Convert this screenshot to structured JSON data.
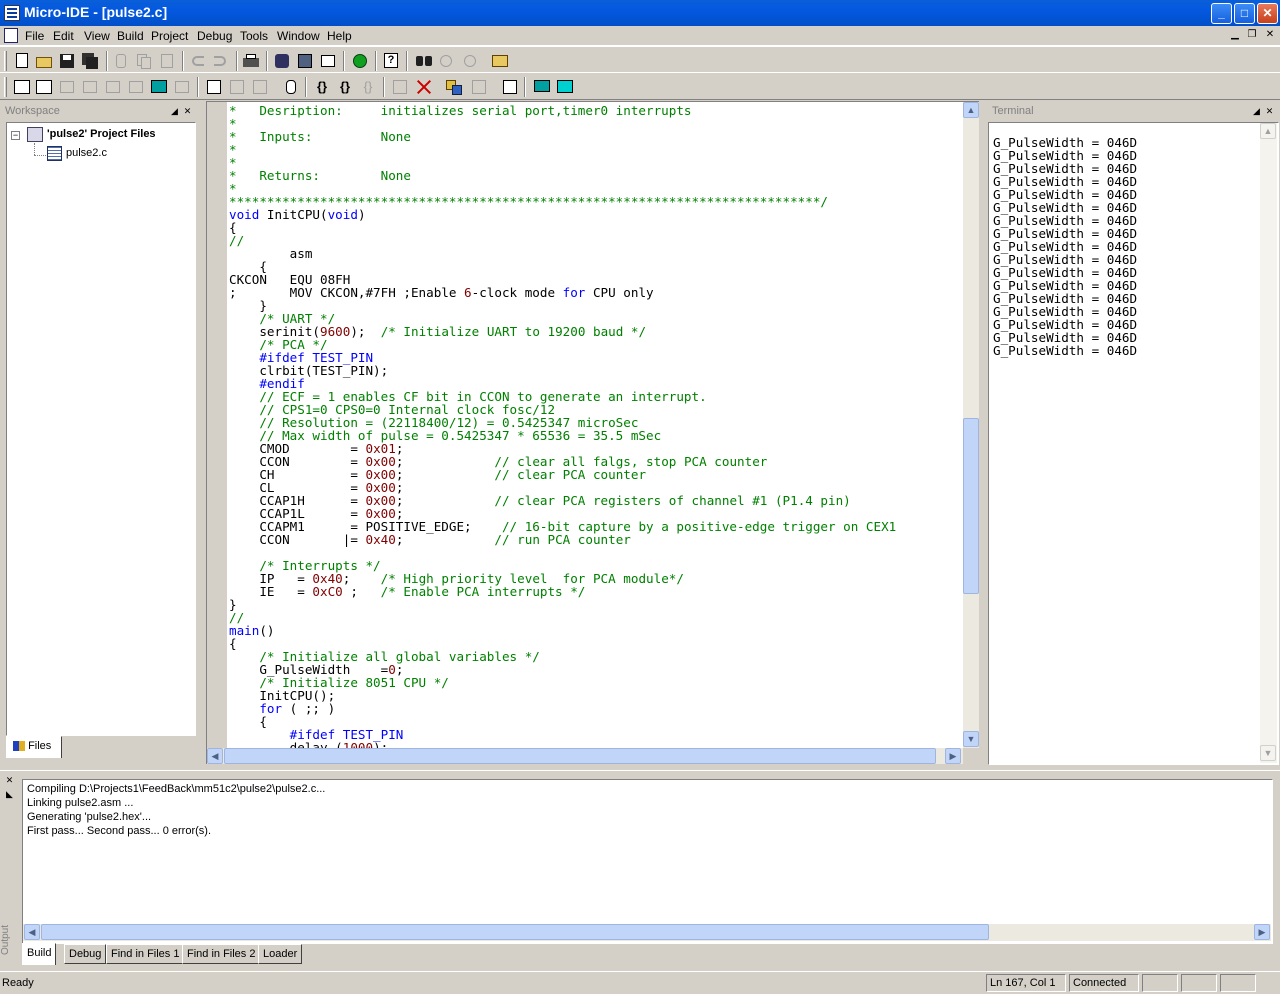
{
  "window": {
    "title": "Micro-IDE - [pulse2.c]",
    "controls": {
      "minimize": "_",
      "maximize": "□",
      "close": "✕"
    }
  },
  "menu": [
    "File",
    "Edit",
    "View",
    "Build",
    "Project",
    "Debug",
    "Tools",
    "Window",
    "Help"
  ],
  "workspace": {
    "title": "Workspace",
    "project_label": "'pulse2' Project Files",
    "file": "pulse2.c",
    "tab": "Files"
  },
  "editor": {
    "lines": [
      [
        [
          "c-cm",
          "*   Desription:     initializes serial port,timer0 interrupts"
        ]
      ],
      [
        [
          "c-cm",
          "*"
        ]
      ],
      [
        [
          "c-cm",
          "*   Inputs:         None"
        ]
      ],
      [
        [
          "c-cm",
          "*"
        ]
      ],
      [
        [
          "c-cm",
          "*"
        ]
      ],
      [
        [
          "c-cm",
          "*   Returns:        None"
        ]
      ],
      [
        [
          "c-cm",
          "*"
        ]
      ],
      [
        [
          "c-cm",
          "******************************************************************************/"
        ]
      ],
      [
        [
          "c-kw",
          "void"
        ],
        [
          "c-tx",
          " InitCPU("
        ],
        [
          "c-kw",
          "void"
        ],
        [
          "c-tx",
          ")"
        ]
      ],
      [
        [
          "c-tx",
          "{"
        ]
      ],
      [
        [
          "c-cm",
          "//"
        ]
      ],
      [
        [
          "c-tx",
          "        asm"
        ]
      ],
      [
        [
          "c-tx",
          "    {"
        ]
      ],
      [
        [
          "c-tx",
          "CKCON   EQU 08FH"
        ]
      ],
      [
        [
          "c-tx",
          ";       MOV CKCON,#7FH ;Enable "
        ],
        [
          "c-num",
          "6"
        ],
        [
          "c-tx",
          "-clock mode "
        ],
        [
          "c-kw",
          "for"
        ],
        [
          "c-tx",
          " CPU only"
        ]
      ],
      [
        [
          "c-tx",
          "    }"
        ]
      ],
      [
        [
          "c-cm",
          "    /* UART */"
        ]
      ],
      [
        [
          "c-tx",
          "    serinit("
        ],
        [
          "c-num",
          "9600"
        ],
        [
          "c-tx",
          ");  "
        ],
        [
          "c-cm",
          "/* Initialize UART to 19200 baud */"
        ]
      ],
      [
        [
          "c-cm",
          "    /* PCA */"
        ]
      ],
      [
        [
          "c-kw",
          "    #ifdef TEST_PIN"
        ]
      ],
      [
        [
          "c-tx",
          "    clrbit(TEST_PIN);"
        ]
      ],
      [
        [
          "c-kw",
          "    #endif"
        ]
      ],
      [
        [
          "c-cm",
          "    // ECF = 1 enables CF bit in CCON to generate an interrupt."
        ]
      ],
      [
        [
          "c-cm",
          "    // CPS1=0 CPS0=0 Internal clock fosc/12"
        ]
      ],
      [
        [
          "c-cm",
          "    // Resolution = (22118400/12) = 0.5425347 microSec"
        ]
      ],
      [
        [
          "c-cm",
          "    // Max width of pulse = 0.5425347 * 65536 = 35.5 mSec"
        ]
      ],
      [
        [
          "c-tx",
          "    CMOD        = "
        ],
        [
          "c-num",
          "0x01"
        ],
        [
          "c-tx",
          ";"
        ]
      ],
      [
        [
          "c-tx",
          "    CCON        = "
        ],
        [
          "c-num",
          "0x00"
        ],
        [
          "c-tx",
          ";            "
        ],
        [
          "c-cm",
          "// clear all falgs, stop PCA counter"
        ]
      ],
      [
        [
          "c-tx",
          "    CH          = "
        ],
        [
          "c-num",
          "0x00"
        ],
        [
          "c-tx",
          ";            "
        ],
        [
          "c-cm",
          "// clear PCA counter"
        ]
      ],
      [
        [
          "c-tx",
          "    CL          = "
        ],
        [
          "c-num",
          "0x00"
        ],
        [
          "c-tx",
          ";"
        ]
      ],
      [
        [
          "c-tx",
          "    CCAP1H      = "
        ],
        [
          "c-num",
          "0x00"
        ],
        [
          "c-tx",
          ";            "
        ],
        [
          "c-cm",
          "// clear PCA registers of channel #1 (P1.4 pin)"
        ]
      ],
      [
        [
          "c-tx",
          "    CCAP1L      = "
        ],
        [
          "c-num",
          "0x00"
        ],
        [
          "c-tx",
          ";"
        ]
      ],
      [
        [
          "c-tx",
          "    CCAPM1      = POSITIVE_EDGE;    "
        ],
        [
          "c-cm",
          "// 16-bit capture by a positive-edge trigger on CEX1"
        ]
      ],
      [
        [
          "c-tx",
          "    CCON       |= "
        ],
        [
          "c-num",
          "0x40"
        ],
        [
          "c-tx",
          ";            "
        ],
        [
          "c-cm",
          "// run PCA counter"
        ]
      ],
      [
        [
          "c-tx",
          ""
        ]
      ],
      [
        [
          "c-cm",
          "    /* Interrupts */"
        ]
      ],
      [
        [
          "c-tx",
          "    IP   = "
        ],
        [
          "c-num",
          "0x40"
        ],
        [
          "c-tx",
          ";    "
        ],
        [
          "c-cm",
          "/* High priority level  for PCA module*/"
        ]
      ],
      [
        [
          "c-tx",
          "    IE   = "
        ],
        [
          "c-num",
          "0xC0"
        ],
        [
          "c-tx",
          " ;   "
        ],
        [
          "c-cm",
          "/* Enable PCA interrupts */"
        ]
      ],
      [
        [
          "c-tx",
          "}"
        ]
      ],
      [
        [
          "c-cm",
          "//"
        ]
      ],
      [
        [
          "c-kw",
          "main"
        ],
        [
          "c-tx",
          "()"
        ]
      ],
      [
        [
          "c-tx",
          "{"
        ]
      ],
      [
        [
          "c-cm",
          "    /* Initialize all global variables */"
        ]
      ],
      [
        [
          "c-tx",
          "    G_PulseWidth    ="
        ],
        [
          "c-num",
          "0"
        ],
        [
          "c-tx",
          ";"
        ]
      ],
      [
        [
          "c-cm",
          "    /* Initialize 8051 CPU */"
        ]
      ],
      [
        [
          "c-tx",
          "    InitCPU();"
        ]
      ],
      [
        [
          "c-kw",
          "    for"
        ],
        [
          "c-tx",
          " ( ;; )"
        ]
      ],
      [
        [
          "c-tx",
          "    {"
        ]
      ],
      [
        [
          "c-kw",
          "        #ifdef TEST_PIN"
        ]
      ],
      [
        [
          "c-tx",
          "        delay ("
        ],
        [
          "c-num",
          "1000"
        ],
        [
          "c-tx",
          ");"
        ]
      ]
    ]
  },
  "terminal": {
    "title": "Terminal",
    "lines": [
      "G_PulseWidth = 046D",
      "G_PulseWidth = 046D",
      "G_PulseWidth = 046D",
      "G_PulseWidth = 046D",
      "G_PulseWidth = 046D",
      "G_PulseWidth = 046D",
      "G_PulseWidth = 046D",
      "G_PulseWidth = 046D",
      "G_PulseWidth = 046D",
      "G_PulseWidth = 046D",
      "G_PulseWidth = 046D",
      "G_PulseWidth = 046D",
      "G_PulseWidth = 046D",
      "G_PulseWidth = 046D",
      "G_PulseWidth = 046D",
      "G_PulseWidth = 046D",
      "G_PulseWidth = 046D"
    ]
  },
  "output": {
    "title": "Output",
    "lines": [
      "Compiling D:\\Projects1\\FeedBack\\mm51c2\\pulse2\\pulse2.c...",
      "Linking pulse2.asm ...",
      "Generating 'pulse2.hex'...",
      "First pass... Second pass... 0 error(s)."
    ],
    "tabs": [
      "Build",
      "Debug",
      "Find in Files 1",
      "Find in Files 2",
      "Loader"
    ]
  },
  "status": {
    "ready": "Ready",
    "position": "Ln 167, Col 1",
    "connection": "Connected"
  },
  "colors": {
    "titlebar": "#0458e0",
    "comment": "#008000",
    "keyword": "#0000ff",
    "number": "#800000",
    "chrome": "#d4d0c8"
  }
}
